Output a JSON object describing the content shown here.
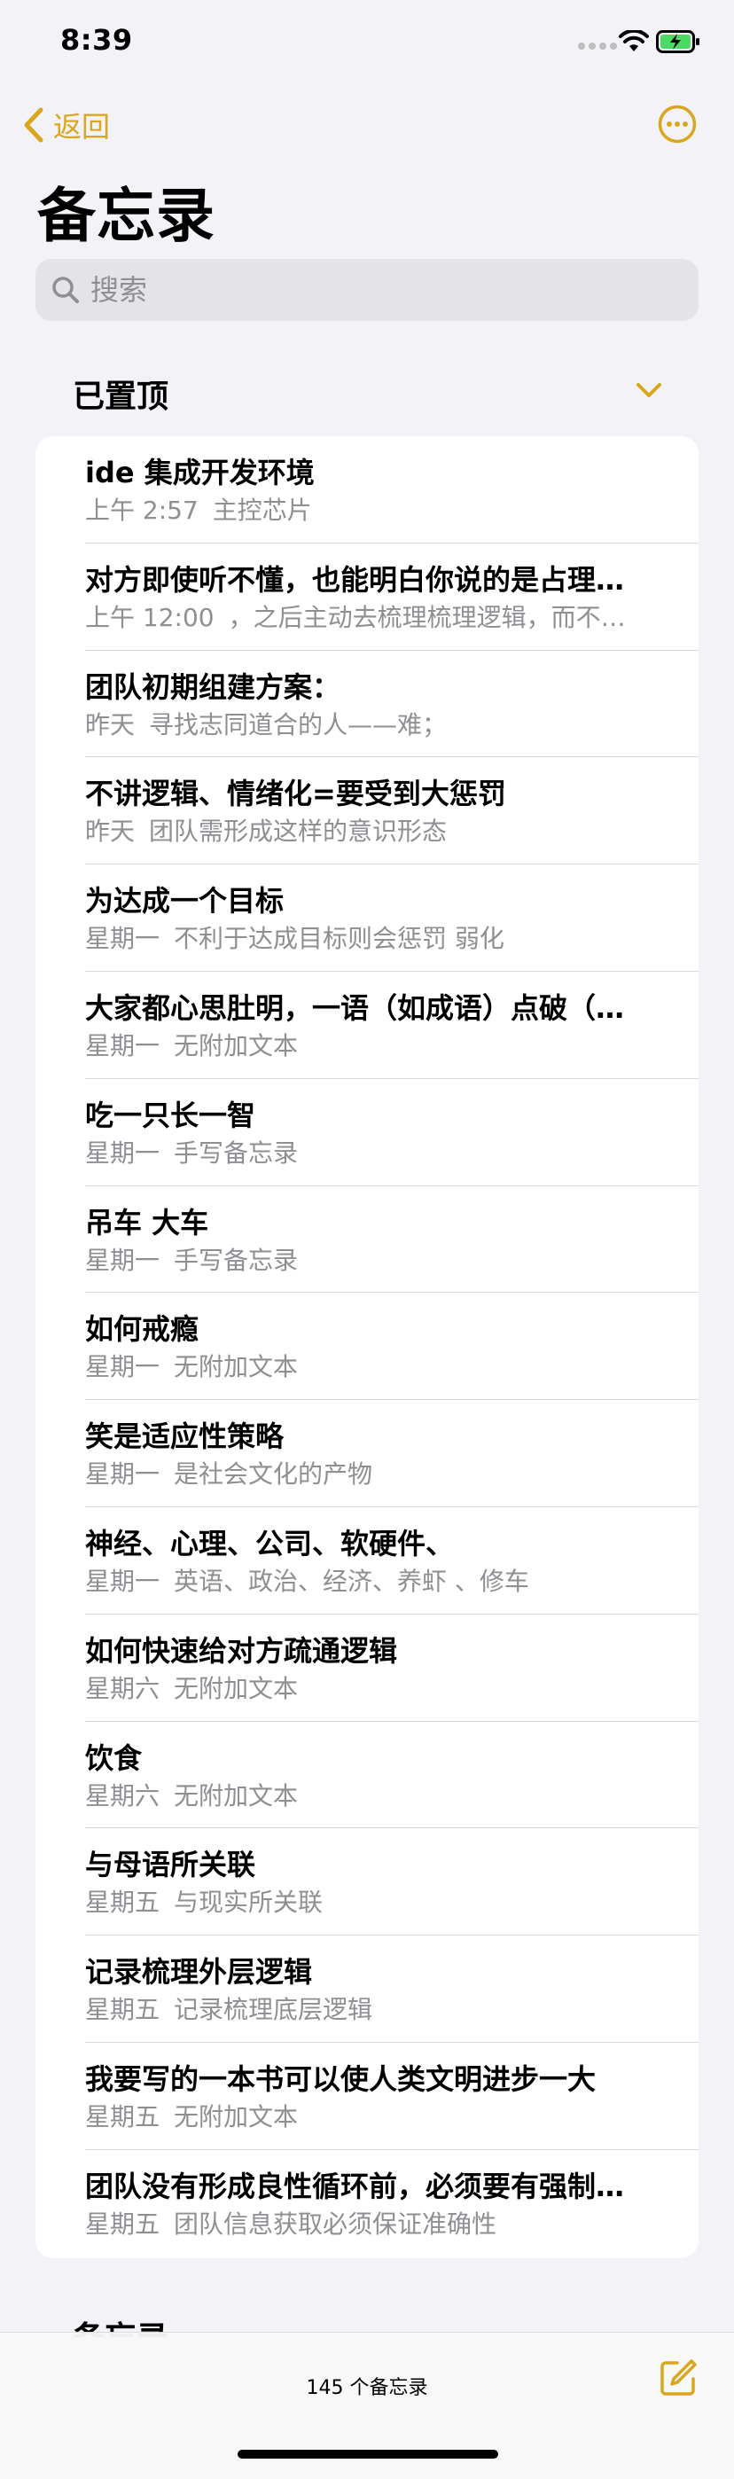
{
  "status": {
    "time": "8:39"
  },
  "nav": {
    "back_label": "返回"
  },
  "title": "备忘录",
  "search": {
    "placeholder": "搜索"
  },
  "pinned_header": "已置顶",
  "notes": [
    {
      "title": "ide 集成开发环境",
      "date": "上午 2:57",
      "preview": "主控芯片"
    },
    {
      "title": "对方即使听不懂，也能明白你说的是占理…",
      "date": "上午 12:00",
      "preview": "，之后主动去梳理梳理逻辑，而不…"
    },
    {
      "title": "团队初期组建方案：",
      "date": "昨天",
      "preview": "寻找志同道合的人——难；"
    },
    {
      "title": "不讲逻辑、情绪化=要受到大惩罚",
      "date": "昨天",
      "preview": "团队需形成这样的意识形态"
    },
    {
      "title": "为达成一个目标",
      "date": "星期一",
      "preview": "不利于达成目标则会惩罚 弱化"
    },
    {
      "title": "大家都心思肚明，一语（如成语）点破（…",
      "date": "星期一",
      "preview": "无附加文本"
    },
    {
      "title": "吃一只长一智",
      "date": "星期一",
      "preview": "手写备忘录"
    },
    {
      "title": "吊车 大车",
      "date": "星期一",
      "preview": "手写备忘录"
    },
    {
      "title": "如何戒瘾",
      "date": "星期一",
      "preview": "无附加文本"
    },
    {
      "title": "笑是适应性策略",
      "date": "星期一",
      "preview": "是社会文化的产物"
    },
    {
      "title": "神经、心理、公司、软硬件、",
      "date": "星期一",
      "preview": "英语、政治、经济、养虾 、修车"
    },
    {
      "title": "如何快速给对方疏通逻辑",
      "date": "星期六",
      "preview": "无附加文本"
    },
    {
      "title": "饮食",
      "date": "星期六",
      "preview": "无附加文本"
    },
    {
      "title": "与母语所关联",
      "date": "星期五",
      "preview": "与现实所关联"
    },
    {
      "title": "记录梳理外层逻辑",
      "date": "星期五",
      "preview": "记录梳理底层逻辑"
    },
    {
      "title": "我要写的一本书可以使人类文明进步一大",
      "date": "星期五",
      "preview": "无附加文本"
    },
    {
      "title": "团队没有形成良性循环前，必须要有强制…",
      "date": "星期五",
      "preview": "团队信息获取必须保证准确性"
    }
  ],
  "next_section_header": "备忘录",
  "toolbar": {
    "count_label": "145 个备忘录"
  },
  "colors": {
    "accent": "#d9a61d",
    "background": "#f2f2f7",
    "secondary_text": "#8e8e93"
  },
  "icons": [
    "signal-icon",
    "wifi-icon",
    "battery-icon",
    "back-chevron-icon",
    "more-icon",
    "search-icon",
    "chevron-down-icon",
    "compose-icon"
  ]
}
